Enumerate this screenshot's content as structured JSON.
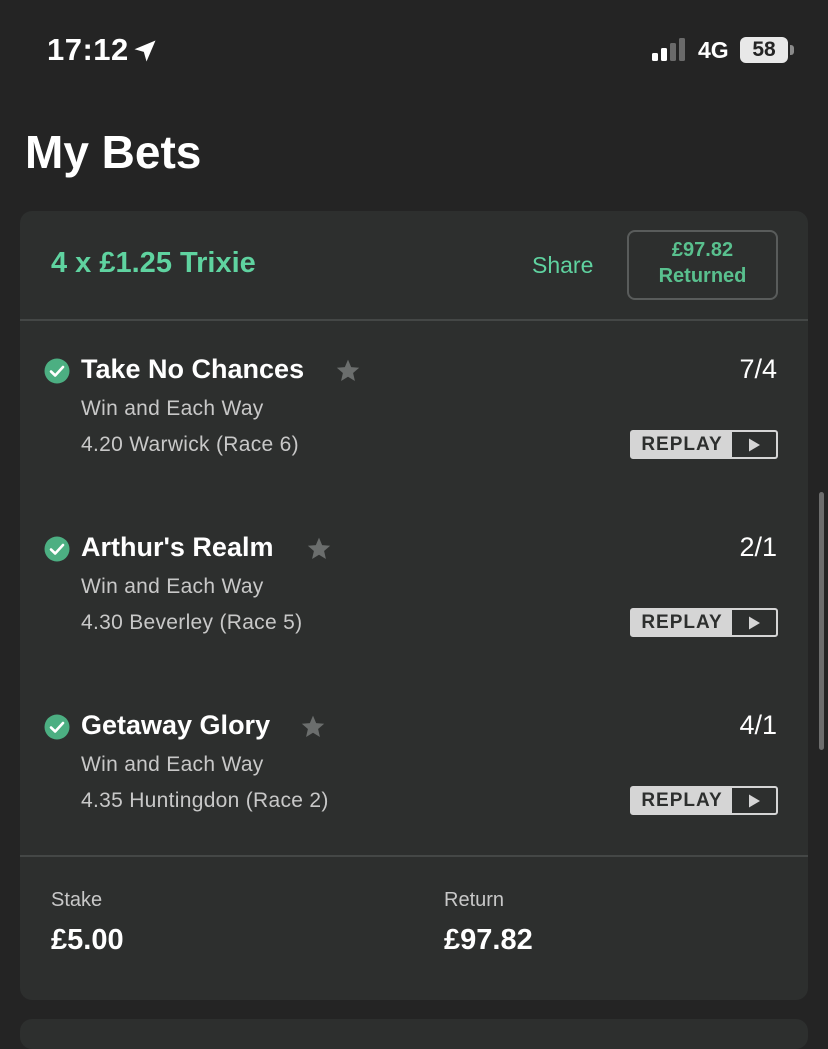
{
  "status_bar": {
    "time": "17:12",
    "network": "4G",
    "battery": "58"
  },
  "page": {
    "title": "My Bets"
  },
  "bet": {
    "title": "4 x £1.25 Trixie",
    "share_label": "Share",
    "returned_amount": "£97.82",
    "returned_label": "Returned",
    "selections": [
      {
        "horse": "Take No Chances",
        "market": "Win and Each Way",
        "race": "4.20 Warwick (Race 6)",
        "odds": "7/4",
        "replay_label": "REPLAY"
      },
      {
        "horse": "Arthur's Realm",
        "market": "Win and Each Way",
        "race": "4.30 Beverley (Race 5)",
        "odds": "2/1",
        "replay_label": "REPLAY"
      },
      {
        "horse": "Getaway Glory",
        "market": "Win and Each Way",
        "race": "4.35 Huntingdon (Race 2)",
        "odds": "4/1",
        "replay_label": "REPLAY"
      }
    ],
    "stake_label": "Stake",
    "stake_value": "£5.00",
    "return_label": "Return",
    "return_value": "£97.82"
  },
  "colors": {
    "background": "#242424",
    "card": "#2d2f2e",
    "accent_green": "#5fd3a0",
    "check_green": "#4caf82",
    "star_grey": "#6b6e6d"
  },
  "icons": {
    "location": "location-arrow-icon",
    "signal": "cell-signal-icon",
    "check": "check-circle-icon",
    "star": "star-icon",
    "play": "play-icon"
  }
}
